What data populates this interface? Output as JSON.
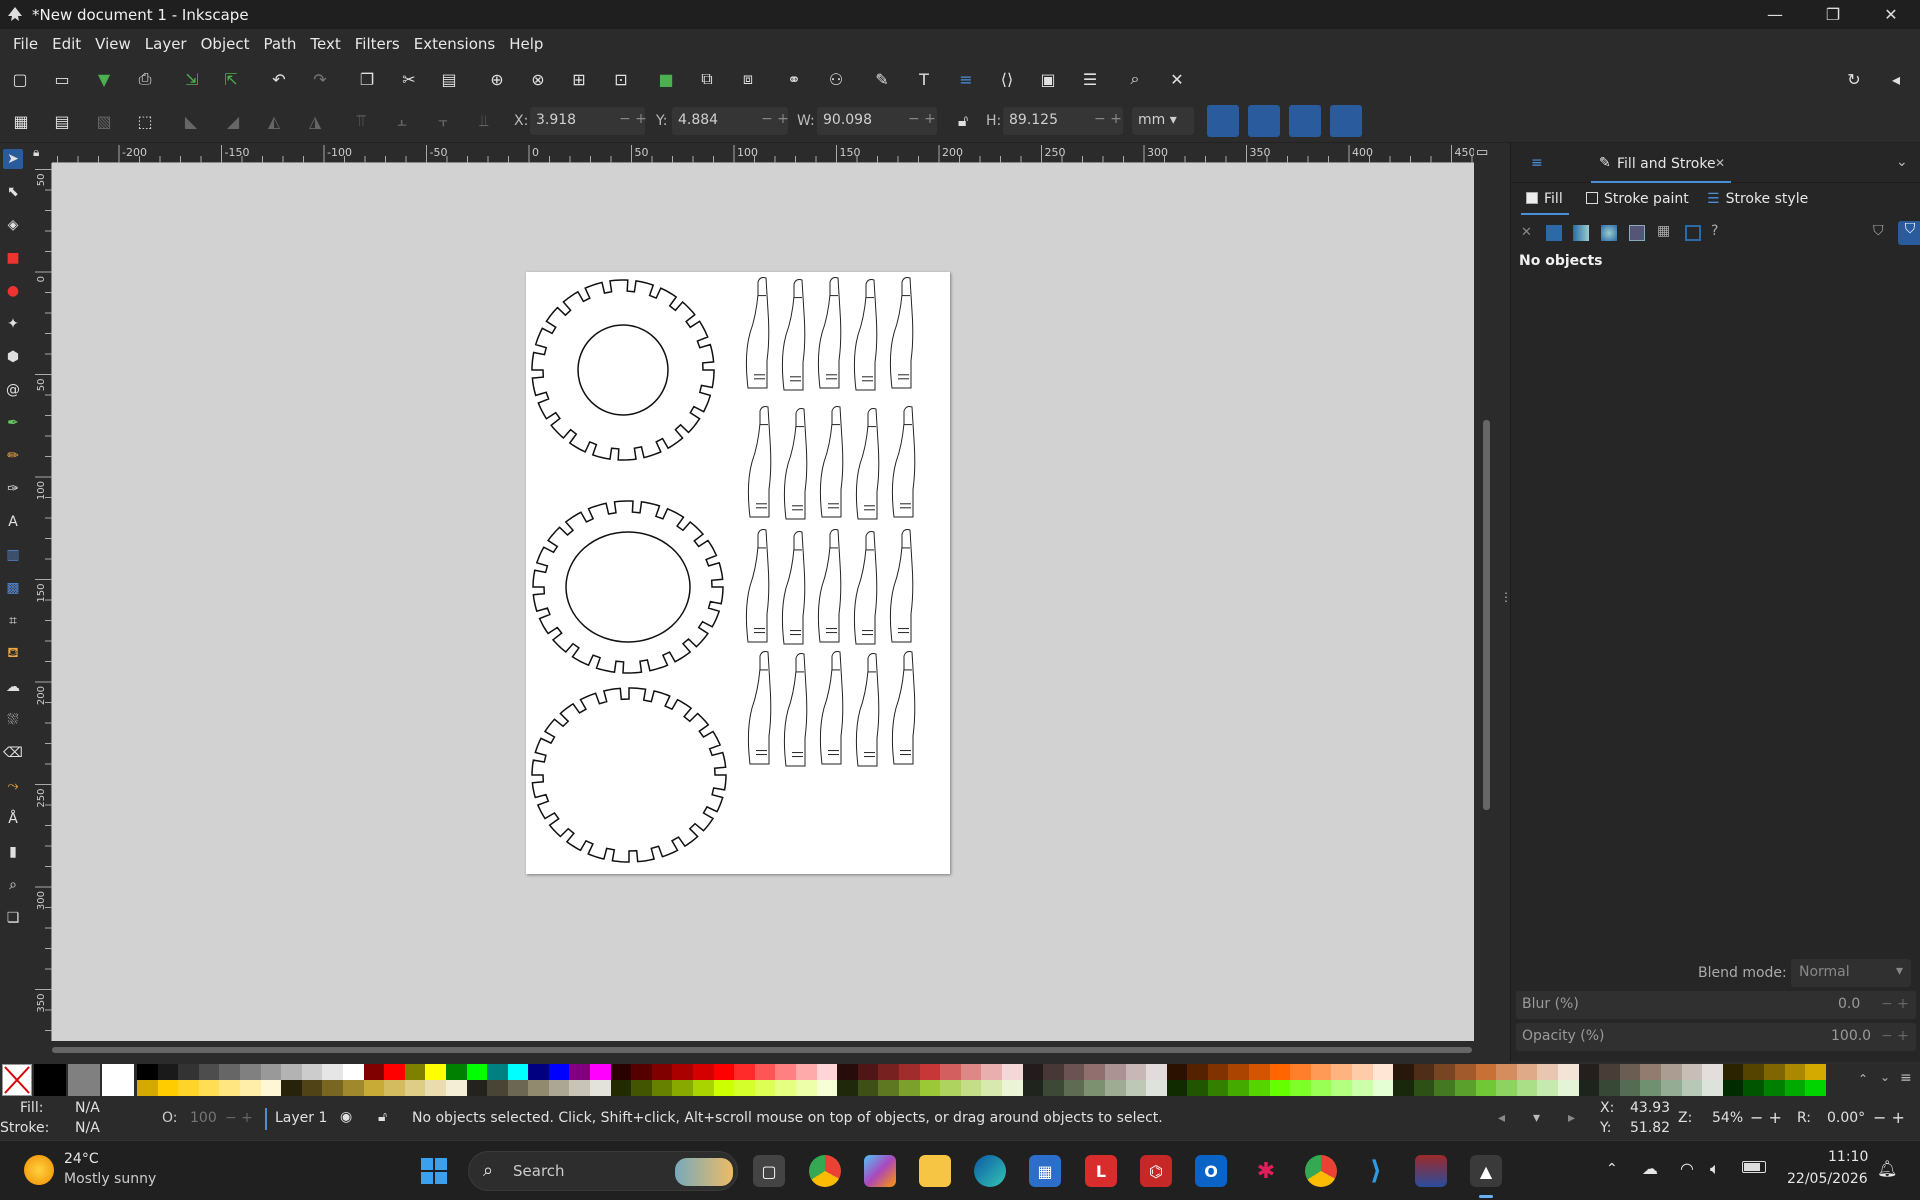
{
  "window": {
    "title": "*New document 1 - Inkscape",
    "minimize": "—",
    "maximize": "❐",
    "close": "✕"
  },
  "menu": [
    "File",
    "Edit",
    "View",
    "Layer",
    "Object",
    "Path",
    "Text",
    "Filters",
    "Extensions",
    "Help"
  ],
  "controls": {
    "x_label": "X:",
    "x_value": "3.918",
    "y_label": "Y:",
    "y_value": "4.884",
    "w_label": "W:",
    "w_value": "90.098",
    "h_label": "H:",
    "h_value": "89.125",
    "unit": "mm",
    "pm": "− +"
  },
  "ruler_h": [
    "-200",
    "-150",
    "-100",
    "-50",
    "0",
    "50",
    "100",
    "150",
    "200",
    "250",
    "300",
    "350",
    "400",
    "450"
  ],
  "ruler_v": [
    "50",
    "0",
    "50",
    "100",
    "150",
    "200",
    "250",
    "300",
    "350"
  ],
  "panel": {
    "tab_title": "Fill and Stroke",
    "tab_close": "✕",
    "subtabs": [
      "Fill",
      "Stroke paint",
      "Stroke style"
    ],
    "fill_unknown": "?",
    "no_objects": "No objects",
    "blend_label": "Blend mode:",
    "blend_value": "Normal",
    "blur_label": "Blur (%)",
    "blur_value": "0.0",
    "opacity_label": "Opacity (%)",
    "opacity_value": "100.0",
    "pm": "− +"
  },
  "palette_row1": [
    "#000000",
    "#1a1a1a",
    "#333333",
    "#4d4d4d",
    "#666666",
    "#808080",
    "#999999",
    "#b3b3b3",
    "#cccccc",
    "#e6e6e6",
    "#ffffff",
    "#800000",
    "#ff0000",
    "#808000",
    "#ffff00",
    "#008000",
    "#00ff00",
    "#008080",
    "#00ffff",
    "#000080",
    "#0000ff",
    "#800080",
    "#ff00ff",
    "#2b0000",
    "#550000",
    "#800000",
    "#aa0000",
    "#d40000",
    "#ff0000",
    "#ff2a2a",
    "#ff5555",
    "#ff8080",
    "#ffaaaa",
    "#ffd5d5",
    "#280b0b",
    "#501616",
    "#782121",
    "#a02c2c",
    "#c83737",
    "#d35f5f",
    "#de8787",
    "#e9afaf",
    "#f4d7d7",
    "#241c1c",
    "#483737",
    "#6c5353",
    "#916f6f",
    "#ac9393",
    "#c8b7b7",
    "#e3dbdb",
    "#2b1100",
    "#552200",
    "#803300",
    "#aa4400",
    "#d45500",
    "#ff6600",
    "#ff7f2a",
    "#ff9955",
    "#ffb380",
    "#ffccaa",
    "#ffe6d5",
    "#28170b",
    "#502d16",
    "#784421",
    "#a05a2c",
    "#c87137",
    "#d38d5f",
    "#deaa87",
    "#e9c6af",
    "#f4e3d7",
    "#241f1c",
    "#483e37",
    "#6c5d53",
    "#917c6f",
    "#ac9d93",
    "#c8beb7",
    "#e3dedb",
    "#2b2200",
    "#554400",
    "#806600",
    "#aa8800",
    "#d4aa00"
  ],
  "palette_row2": [
    "#d4aa00",
    "#ffcc00",
    "#ffd42a",
    "#ffdd55",
    "#ffe680",
    "#ffeeaa",
    "#fff6d5",
    "#28220b",
    "#504416",
    "#786721",
    "#a0892c",
    "#c8ab37",
    "#d3bc5f",
    "#decd87",
    "#e9ddaf",
    "#f4eed7",
    "#24221c",
    "#484537",
    "#6c6753",
    "#918a6f",
    "#aca793",
    "#c8c4b7",
    "#e3e2db",
    "#222b00",
    "#445500",
    "#668000",
    "#88aa00",
    "#aad400",
    "#ccff00",
    "#d4ff2a",
    "#ddff55",
    "#e5ff80",
    "#eeffaa",
    "#f6ffd5",
    "#1f280b",
    "#3e5016",
    "#5d7821",
    "#7ca02c",
    "#9bc837",
    "#afd35f",
    "#c3de87",
    "#d7e9af",
    "#ebf4d7",
    "#1f241c",
    "#3e4837",
    "#5d6c53",
    "#7c916f",
    "#9dac93",
    "#bec8b7",
    "#dee3db",
    "#112b00",
    "#225500",
    "#338000",
    "#44aa00",
    "#55d400",
    "#66ff00",
    "#7fff2a",
    "#99ff55",
    "#b3ff80",
    "#ccffaa",
    "#e5ffd5",
    "#17280b",
    "#2d5016",
    "#447821",
    "#5aa02c",
    "#71c837",
    "#8dd35f",
    "#aade87",
    "#c6e9af",
    "#e3f4d7",
    "#1c241c",
    "#374837",
    "#536c53",
    "#6f916f",
    "#93ac93",
    "#b7c8b7",
    "#dbe3db",
    "#002b00",
    "#005500",
    "#008000",
    "#00aa00",
    "#00d400"
  ],
  "status": {
    "fill_label": "Fill:",
    "fill_value": "N/A",
    "stroke_label": "Stroke:",
    "stroke_value": "N/A",
    "opacity_label": "O:",
    "opacity_value": "100",
    "layer": "Layer 1",
    "message": "No objects selected. Click, Shift+click, Alt+scroll mouse on top of objects, or drag around objects to select.",
    "x_label": "X:",
    "x_value": "43.93",
    "y_label": "Y:",
    "y_value": "51.82",
    "zoom_label": "Z:",
    "zoom_value": "54%",
    "rotate_label": "R:",
    "rotate_value": "0.00°",
    "pm": "− +"
  },
  "taskbar": {
    "temp": "24°C",
    "weather": "Mostly sunny",
    "search_placeholder": "Search",
    "time": "11:10",
    "date": "22/05/2026",
    "app_l": "L"
  },
  "colors": {
    "accent": "#2a5b9c",
    "canvas": "#d2d2d2",
    "panel": "#262626",
    "ui": "#2b2b2b"
  }
}
